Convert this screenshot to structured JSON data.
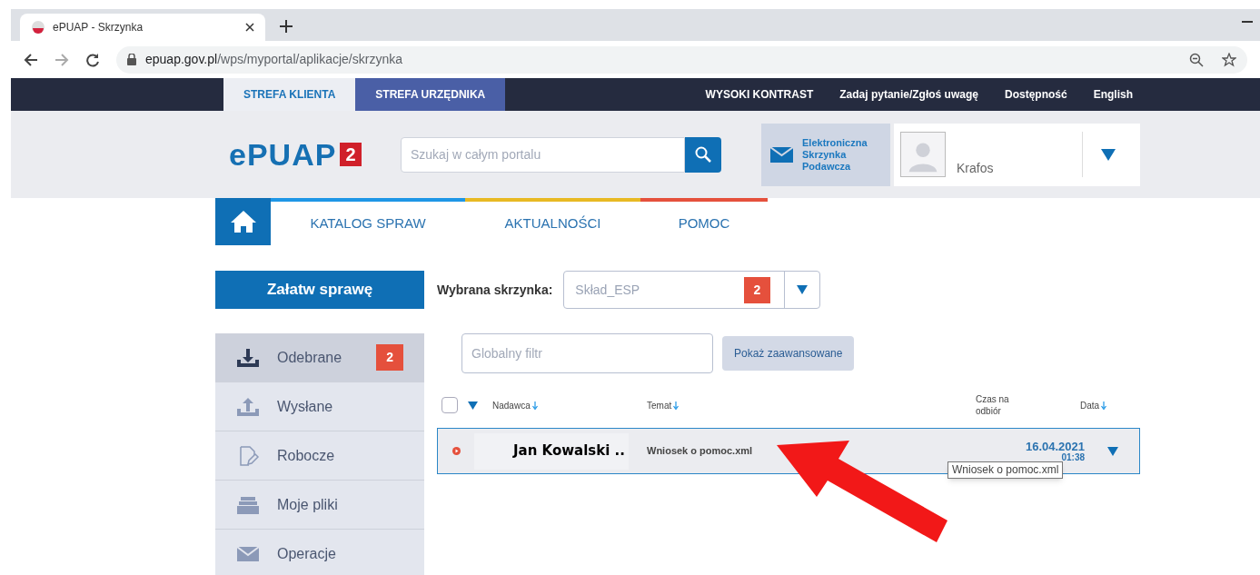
{
  "browser": {
    "tab_title": "ePUAP - Skrzynka",
    "url_domain": "epuap.gov.pl",
    "url_path": "/wps/myportal/aplikacje/skrzynka"
  },
  "top_bar": {
    "zones": [
      {
        "label": "STREFA KLIENTA",
        "selected": true
      },
      {
        "label": "STREFA URZĘDNIKA",
        "selected": false
      }
    ],
    "links": [
      "WYSOKI KONTRAST",
      "Zadaj pytanie/Zgłoś uwagę",
      "Dostępność",
      "English"
    ]
  },
  "header": {
    "logo": "ePUAP",
    "logo_badge": "2",
    "search_placeholder": "Szukaj w całym portalu",
    "inbox_link": "Elektroniczna Skrzynka Podawcza",
    "user_name": "Krafos"
  },
  "nav": [
    {
      "label": "KATALOG SPRAW",
      "color": "#1e96e6"
    },
    {
      "label": "AKTUALNOŚCI",
      "color": "#e8b923"
    },
    {
      "label": "POMOC",
      "color": "#e5503c"
    }
  ],
  "sidebar": {
    "action": "Załatw sprawę",
    "items": [
      {
        "kind": "inbox",
        "label": "Odebrane",
        "badge": "2",
        "selected": true
      },
      {
        "kind": "outbox",
        "label": "Wysłane",
        "selected": false
      },
      {
        "kind": "draft",
        "label": "Robocze",
        "selected": false
      },
      {
        "kind": "files",
        "label": "Moje pliki",
        "selected": false
      },
      {
        "kind": "mail",
        "label": "Operacje",
        "selected": false
      }
    ]
  },
  "mailbox": {
    "label": "Wybrana skrzynka:",
    "value": "Skład_ESP",
    "badge": "2"
  },
  "filter": {
    "placeholder": "Globalny filtr",
    "button": "Pokaż zaawansowane"
  },
  "table": {
    "select_all_checked": false,
    "columns": [
      "Nadawca",
      "Temat",
      "Czas na odbiór",
      "Data"
    ],
    "rows": [
      {
        "unread": true,
        "selected": true,
        "sender": "Jan Kowalski ..",
        "subject": "Wniosek o pomoc.xml",
        "date": "16.04.2021",
        "time": "01:38"
      }
    ]
  },
  "tooltip": "Wniosek o pomoc.xml"
}
